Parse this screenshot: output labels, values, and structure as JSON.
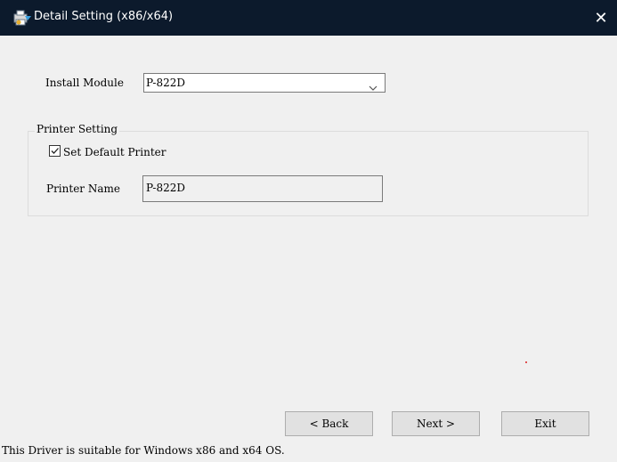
{
  "window": {
    "title": "Detail Setting (x86/x64)",
    "close_glyph": "✕",
    "icon": "printer-install-icon"
  },
  "install_module": {
    "label": "Install Module",
    "value": "P-822D"
  },
  "printer_setting": {
    "group_title": "Printer Setting",
    "set_default_label": "Set Default Printer",
    "set_default_checked": true,
    "printer_name_label": "Printer Name",
    "printer_name_value": "P-822D"
  },
  "buttons": {
    "back": "< Back",
    "next": "Next >",
    "exit": "Exit"
  },
  "status_text": "This Driver is suitable for Windows x86 and x64 OS.",
  "colors": {
    "titlebar_bg": "#0c1a2c",
    "window_bg": "#f0f0f0"
  }
}
